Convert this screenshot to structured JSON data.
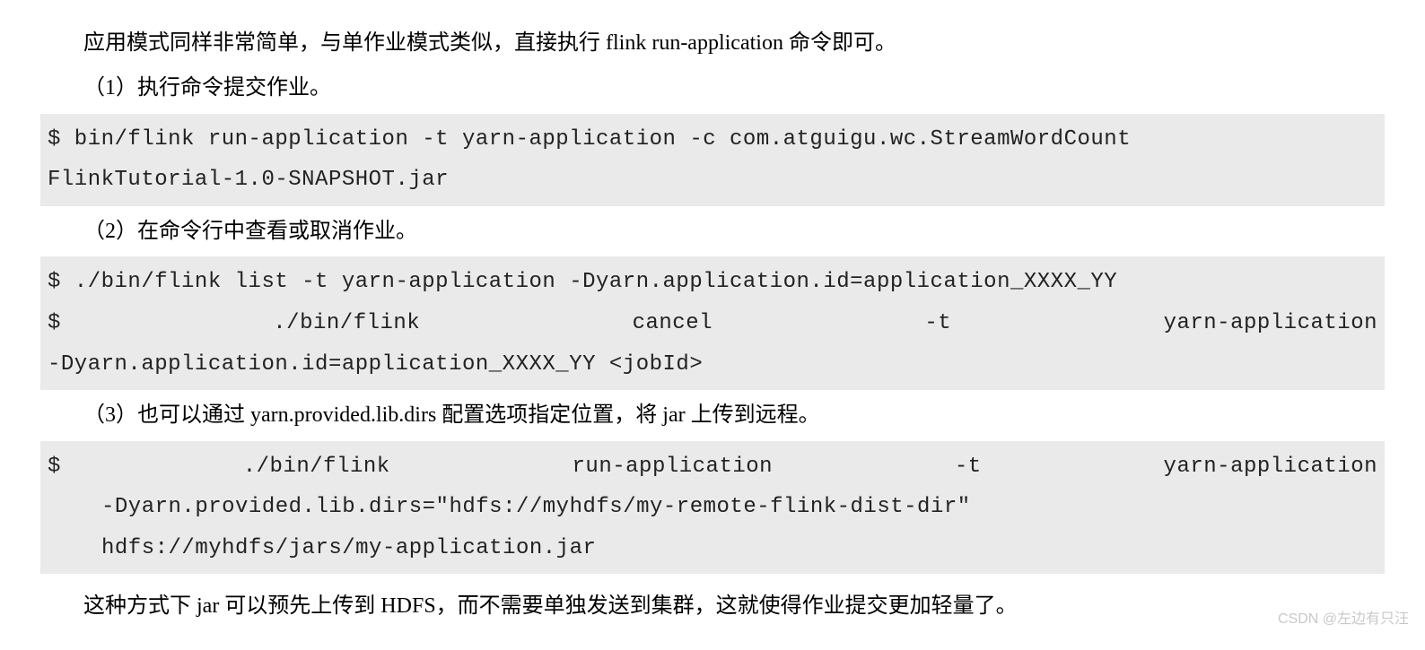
{
  "intro": "应用模式同样非常简单，与单作业模式类似，直接执行 flink run-application 命令即可。",
  "step1_title": "（1）执行命令提交作业。",
  "code1": {
    "line1": "$ bin/flink run-application -t yarn-application -c com.atguigu.wc.StreamWordCount",
    "line2": "FlinkTutorial-1.0-SNAPSHOT.jar"
  },
  "step2_title": "（2）在命令行中查看或取消作业。",
  "code2": {
    "line1": "$ ./bin/flink list -t yarn-application -Dyarn.application.id=application_XXXX_YY",
    "line2": "$ ./bin/flink cancel -t yarn-application",
    "line3": "-Dyarn.application.id=application_XXXX_YY <jobId>"
  },
  "step3_title": "（3）也可以通过 yarn.provided.lib.dirs 配置选项指定位置，将 jar 上传到远程。",
  "code3": {
    "line1": "$ ./bin/flink run-application -t yarn-application",
    "line2": "-Dyarn.provided.lib.dirs=\"hdfs://myhdfs/my-remote-flink-dist-dir\"",
    "line3": "hdfs://myhdfs/jars/my-application.jar"
  },
  "closing": "这种方式下 jar 可以预先上传到 HDFS，而不需要单独发送到集群，这就使得作业提交更加轻量了。",
  "watermark": "CSDN @左边有只汪"
}
